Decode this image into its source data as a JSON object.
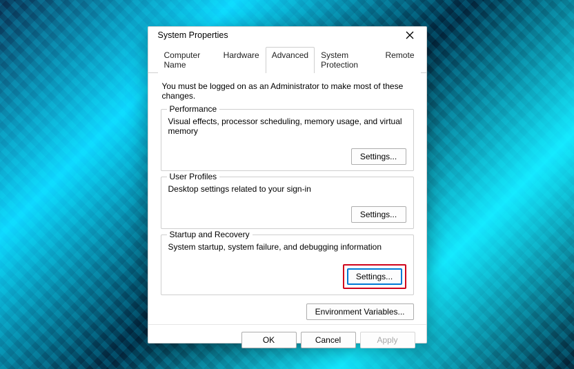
{
  "window": {
    "title": "System Properties"
  },
  "tabs": {
    "computer_name": "Computer Name",
    "hardware": "Hardware",
    "advanced": "Advanced",
    "system_protection": "System Protection",
    "remote": "Remote"
  },
  "content": {
    "admin_note": "You must be logged on as an Administrator to make most of these changes.",
    "performance": {
      "legend": "Performance",
      "desc": "Visual effects, processor scheduling, memory usage, and virtual memory",
      "settings_label": "Settings..."
    },
    "user_profiles": {
      "legend": "User Profiles",
      "desc": "Desktop settings related to your sign-in",
      "settings_label": "Settings..."
    },
    "startup_recovery": {
      "legend": "Startup and Recovery",
      "desc": "System startup, system failure, and debugging information",
      "settings_label": "Settings..."
    },
    "env_vars_label": "Environment Variables..."
  },
  "footer": {
    "ok": "OK",
    "cancel": "Cancel",
    "apply": "Apply"
  }
}
